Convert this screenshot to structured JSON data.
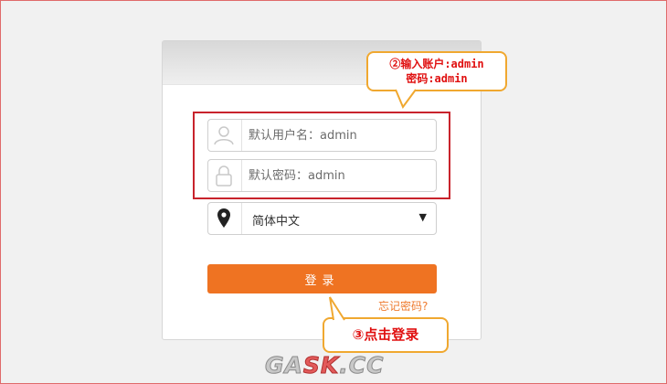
{
  "login": {
    "username_placeholder": "默认用户名：admin",
    "password_placeholder": "默认密码：admin",
    "language": "简体中文",
    "submit_label": "登录",
    "forgot_link": "忘记密码?"
  },
  "annotations": {
    "step2_line1": "②输入账户:admin",
    "step2_line2": "密码:admin",
    "step3": "③点击登录"
  },
  "watermark": {
    "part1": "GA",
    "part2": "SK",
    "part3": ".CC"
  },
  "icons": {
    "username": "user-icon",
    "password": "lock-icon",
    "language": "location-pin-icon",
    "dropdown": "caret-down-icon"
  },
  "colors": {
    "accent": "#ef7322",
    "highlight": "#c8232c",
    "annotation_text": "#e01010",
    "bubble_border": "#f0a830"
  }
}
